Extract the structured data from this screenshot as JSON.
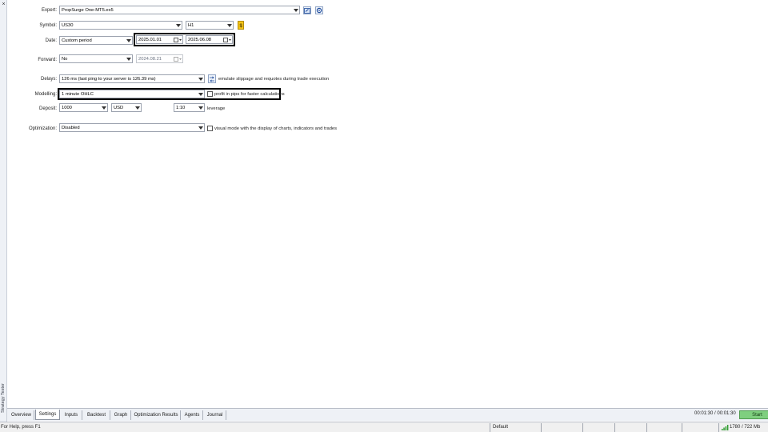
{
  "side_panel": {
    "title": "Strategy Tester",
    "close_glyph": "×"
  },
  "form": {
    "expert": {
      "label": "Expert:",
      "value": "PropSurge One-MT5.ex5"
    },
    "symbol": {
      "label": "Symbol:",
      "value": "US30",
      "timeframe": "H1"
    },
    "date": {
      "label": "Date:",
      "mode": "Custom period",
      "from": "2025.01.01",
      "to": "2025.06.08"
    },
    "forward": {
      "label": "Forward:",
      "mode": "No",
      "date": "2024.08.21"
    },
    "delays": {
      "label": "Delays:",
      "value": "126 ms (last ping to your server is 126.39 ms)",
      "note": "emulate slippage and requotes during trade execution"
    },
    "modelling": {
      "label": "Modelling:",
      "value": "1 minute OHLC",
      "checkbox_label": "profit in pips for faster calculations"
    },
    "deposit": {
      "label": "Deposit:",
      "amount": "1000",
      "currency": "USD",
      "leverage": "1:10",
      "leverage_label": "leverage"
    },
    "optimization": {
      "label": "Optimization:",
      "value": "Disabled",
      "visual_label": "visual mode with the display of charts, indicators and trades"
    }
  },
  "tabs": [
    "Overview",
    "Settings",
    "Inputs",
    "Backtest",
    "Graph",
    "Optimization Results",
    "Agents",
    "Journal"
  ],
  "active_tab": "Settings",
  "timer": "00:01:30 / 00:01:30",
  "start_label": "Start",
  "status": {
    "help": "For Help, press F1",
    "profile": "Default",
    "memory": "1780 / 722 Mb"
  },
  "icons": {
    "expert_edit": "edit-icon",
    "expert_settings": "settings-gear-icon",
    "symbol_props": "symbol-properties-icon",
    "delays_btn": "delay-settings-icon"
  },
  "colors": {
    "start_button": "#7fcf7f",
    "highlight_border": "#000000"
  }
}
